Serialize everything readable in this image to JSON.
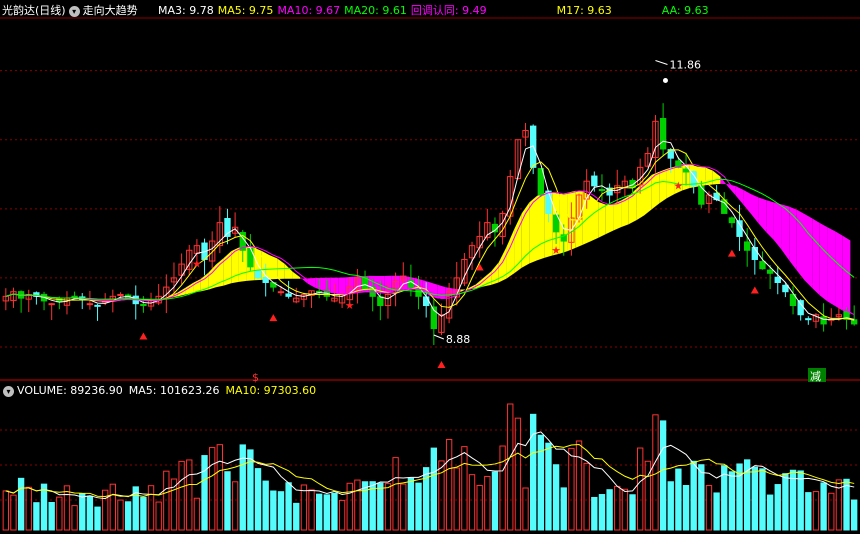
{
  "header": {
    "stock_name": "光韵达",
    "period": "(日线)",
    "indicator_name": "走向大趋势",
    "ma_readouts": [
      {
        "label": "MA3: 9.78",
        "color": "#ffffff"
      },
      {
        "label": "MA5: 9.75",
        "color": "#ffff00"
      },
      {
        "label": "MA10: 9.67",
        "color": "#ff00ff"
      },
      {
        "label": "MA20: 9.61",
        "color": "#00ff00"
      },
      {
        "label": "回调认同: 9.49",
        "color": "#ff00ff"
      },
      {
        "label": "M17: 9.63",
        "color": "#ffff00"
      },
      {
        "label": "AA: 9.63",
        "color": "#00ff00"
      }
    ]
  },
  "volume_header": {
    "readouts": [
      {
        "label": "VOLUME: 89236.90",
        "color": "#ffffff"
      },
      {
        "label": "MA5: 101623.26",
        "color": "#ffffff"
      },
      {
        "label": "MA10: 97303.60",
        "color": "#ffff00"
      }
    ]
  },
  "annotations": {
    "high_label": "11.86",
    "low_label": "8.88",
    "signal_s": "$",
    "signal_jian": "减"
  },
  "colors": {
    "up": "#ff3232",
    "down": "#54fcfc",
    "green_candle": "#00d000",
    "band_pink": "#ff00ff",
    "band_yellow": "#ffff00",
    "grid": "#8b0000",
    "ma_white": "#ffffff",
    "ma_yellow": "#ffff00",
    "ma_magenta": "#ff00ff",
    "ma_green": "#00ff00"
  },
  "chart_data": {
    "type": "candlestick",
    "price_range": [
      8.5,
      12.3
    ],
    "y_ticks": [
      8.75,
      9.5,
      10.25,
      11.0,
      11.75
    ],
    "high": 11.86,
    "low": 8.88,
    "close_series": [
      9.3,
      9.35,
      9.28,
      9.32,
      9.3,
      9.25,
      9.22,
      9.24,
      9.28,
      9.3,
      9.26,
      9.22,
      9.2,
      9.25,
      9.3,
      9.32,
      9.28,
      9.22,
      9.2,
      9.26,
      9.3,
      9.4,
      9.5,
      9.65,
      9.8,
      9.85,
      9.7,
      9.9,
      10.1,
      9.95,
      10.05,
      9.8,
      9.62,
      9.5,
      9.45,
      9.4,
      9.35,
      9.3,
      9.28,
      9.32,
      9.36,
      9.34,
      9.3,
      9.28,
      9.32,
      9.4,
      9.5,
      9.38,
      9.3,
      9.2,
      9.32,
      9.46,
      9.52,
      9.4,
      9.3,
      9.2,
      8.95,
      9.1,
      9.35,
      9.5,
      9.7,
      9.85,
      9.95,
      10.1,
      10.0,
      10.2,
      10.6,
      11.0,
      11.1,
      10.7,
      10.4,
      10.2,
      10.0,
      9.9,
      10.15,
      10.4,
      10.55,
      10.5,
      10.45,
      10.4,
      10.5,
      10.55,
      10.48,
      10.7,
      10.85,
      11.2,
      10.9,
      10.8,
      10.7,
      10.65,
      10.5,
      10.3,
      10.4,
      10.35,
      10.2,
      10.1,
      9.95,
      9.8,
      9.7,
      9.6,
      9.55,
      9.45,
      9.35,
      9.2,
      9.1,
      9.05,
      9.1,
      9.0,
      9.05,
      9.1,
      9.05,
      9.0
    ]
  }
}
